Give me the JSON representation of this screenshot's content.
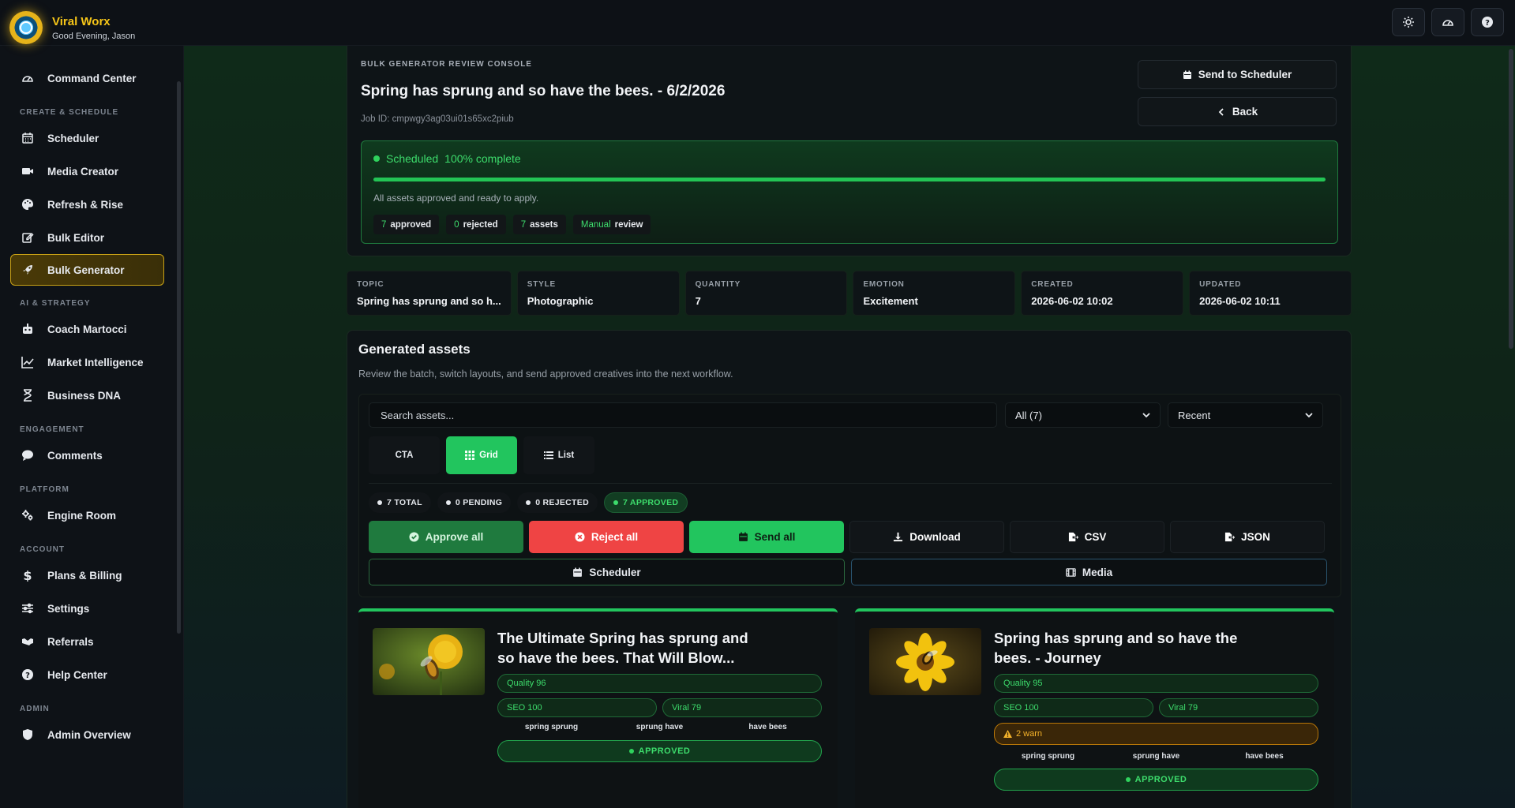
{
  "app": {
    "brand_name": "Viral Worx",
    "greeting": "Good Evening, Jason",
    "top_icons": [
      "sun-icon",
      "gauge-icon",
      "help-icon"
    ]
  },
  "sidebar": {
    "top_item": "Command Center",
    "sections": {
      "create": "CREATE & SCHEDULE",
      "ai": "AI & STRATEGY",
      "engagement": "ENGAGEMENT",
      "platform": "PLATFORM",
      "account": "ACCOUNT",
      "admin": "ADMIN"
    },
    "items": {
      "scheduler": "Scheduler",
      "media_creator": "Media Creator",
      "refresh_rise": "Refresh & Rise",
      "bulk_editor": "Bulk Editor",
      "bulk_generator": "Bulk Generator",
      "coach": "Coach Martocci",
      "market": "Market Intelligence",
      "dna": "Business DNA",
      "comments": "Comments",
      "engine": "Engine Room",
      "plans": "Plans & Billing",
      "settings": "Settings",
      "referrals": "Referrals",
      "help": "Help Center",
      "admin_overview": "Admin Overview"
    },
    "active": "Bulk Generator"
  },
  "header": {
    "eyebrow": "BULK GENERATOR REVIEW CONSOLE",
    "title": "Spring has sprung and so have the bees. - 6/2/2026",
    "job_id": "Job ID: cmpwgy3ag03ui01s65xc2piub",
    "send_to_scheduler": "Send to Scheduler",
    "back": "Back"
  },
  "status": {
    "label": "Scheduled",
    "percent_text": "100% complete",
    "progress": 1.0,
    "note": "All assets approved and ready to apply.",
    "chips": [
      {
        "num": "7",
        "label": "approved"
      },
      {
        "num": "0",
        "label": "rejected"
      },
      {
        "num": "7",
        "label": "assets"
      },
      {
        "num": "Manual",
        "label": "review"
      }
    ]
  },
  "meta": [
    {
      "label": "TOPIC",
      "value": "Spring has sprung and so h..."
    },
    {
      "label": "STYLE",
      "value": "Photographic"
    },
    {
      "label": "QUANTITY",
      "value": "7"
    },
    {
      "label": "EMOTION",
      "value": "Excitement"
    },
    {
      "label": "CREATED",
      "value": "2026-06-02 10:02"
    },
    {
      "label": "UPDATED",
      "value": "2026-06-02 10:11"
    }
  ],
  "assets": {
    "title": "Generated assets",
    "subtitle": "Review the batch, switch layouts, and send approved creatives into the next workflow.",
    "search_placeholder": "Search assets...",
    "filter_value": "All (7)",
    "sort_value": "Recent",
    "views": {
      "cta": "CTA",
      "grid": "Grid",
      "list": "List"
    },
    "pills": {
      "total": "7 TOTAL",
      "pending": "0 PENDING",
      "rejected": "0 REJECTED",
      "approved": "7 APPROVED"
    },
    "actions": {
      "approve_all": "Approve all",
      "reject_all": "Reject all",
      "send_all": "Send all",
      "download": "Download",
      "csv": "CSV",
      "json": "JSON",
      "scheduler": "Scheduler",
      "media": "Media"
    },
    "cards": [
      {
        "title": "The Ultimate Spring has sprung and so have the bees. That Will Blow...",
        "quality": "Quality 96",
        "seo": "SEO 100",
        "viral": "Viral 79",
        "keywords": [
          "spring sprung",
          "sprung have",
          "have bees"
        ],
        "status": "APPROVED"
      },
      {
        "title": "Spring has sprung and so have the bees. - Journey",
        "quality": "Quality 95",
        "seo": "SEO 100",
        "viral": "Viral 79",
        "warn": "2 warn",
        "keywords": [
          "spring sprung",
          "sprung have",
          "have bees"
        ],
        "status": "APPROVED"
      }
    ]
  },
  "colors": {
    "accent_green": "#22c55e",
    "brand_gold": "#f5c518",
    "reject_red": "#ef4444",
    "warn_amber": "#f5b32a"
  }
}
